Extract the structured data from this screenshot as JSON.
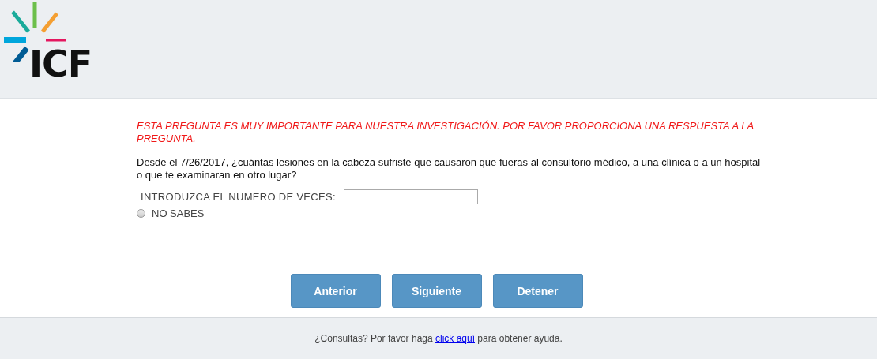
{
  "header": {
    "logo_text": "ICF"
  },
  "warning": "ESTA PREGUNTA ES MUY IMPORTANTE PARA NUESTRA INVESTIGACIÓN. POR FAVOR PROPORCIONA UNA RESPUESTA A LA PREGUNTA.",
  "question": "Desde el 7/26/2017, ¿cuántas lesiones en la cabeza sufriste que causaron que fueras al consultorio médico, a una clínica o a un hospital o que te examinaran en otro lugar?",
  "count_field": {
    "label": "INTRODUZCA EL NUMERO DE VECES:"
  },
  "dont_know": {
    "label": "NO SABES",
    "checked": false
  },
  "buttons": [
    {
      "label": "Anterior"
    },
    {
      "label": "Siguiente"
    },
    {
      "label": "Detener"
    }
  ],
  "footer": {
    "text_before": "¿Consultas? Por favor haga",
    "link": "click aquí",
    "text_after": "para obtener ayuda."
  }
}
